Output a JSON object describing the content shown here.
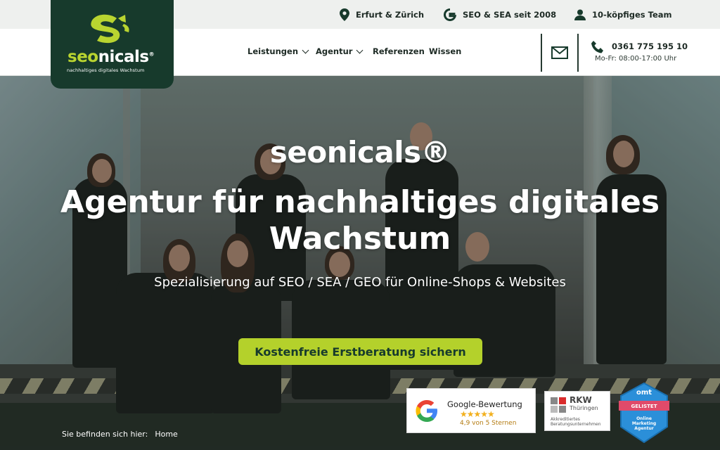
{
  "topbar": {
    "location": "Erfurt & Zürich",
    "since": "SEO & SEA seit 2008",
    "team": "10-köpfiges Team"
  },
  "logo": {
    "word_part1": "seo",
    "word_part2": "nicals",
    "registered": "®",
    "tagline": "nachhaltiges digitales Wachstum"
  },
  "nav": {
    "items": [
      {
        "label": "Leistungen",
        "dropdown": true
      },
      {
        "label": "Agentur",
        "dropdown": true
      },
      {
        "label": "Referenzen",
        "dropdown": false
      },
      {
        "label": "Wissen",
        "dropdown": false
      }
    ]
  },
  "contact": {
    "phone": "0361 775 195 10",
    "hours": "Mo-Fr: 08:00-17:00 Uhr"
  },
  "hero": {
    "brand": "seonicals®",
    "title": "Agentur für nachhaltiges digitales Wachstum",
    "subtitle": "Spezialisierung auf SEO / SEA / GEO für Online-Shops & Websites",
    "cta_label": "Kostenfreie Erstberatung sichern"
  },
  "badges": {
    "google": {
      "title": "Google-Bewertung",
      "stars": "★★★★★",
      "rating": "4,9 von 5 Sternen"
    },
    "rkw": {
      "name": "RKW",
      "region": "Thüringen",
      "note": "Akkreditiertes Beratungsunternehmen"
    },
    "omt": {
      "top": "omt",
      "label": "GELISTET",
      "desc": "Online Marketing Agentur"
    }
  },
  "breadcrumb": {
    "prefix": "Sie befinden sich hier:",
    "current": "Home"
  },
  "colors": {
    "brand_dark": "#173a2c",
    "brand_lime": "#b4d12b",
    "topbar_bg": "#eef0ee"
  }
}
